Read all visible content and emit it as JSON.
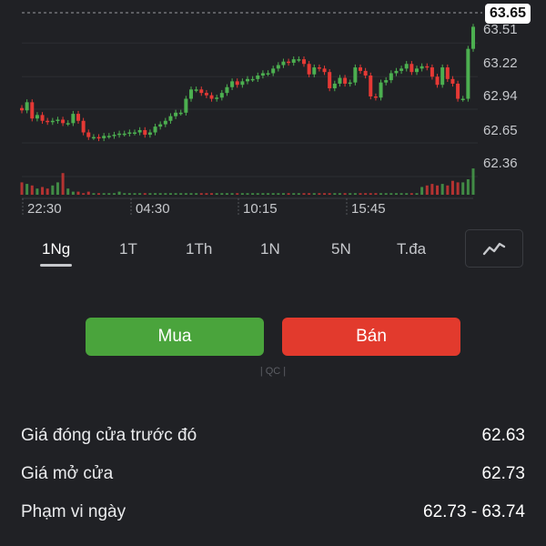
{
  "chart": {
    "last_price": "63.65",
    "y_axis_labels": [
      "63.51",
      "63.22",
      "62.94",
      "62.65",
      "62.36"
    ],
    "time_labels": [
      "22:30",
      "04:30",
      "10:15",
      "15:45"
    ],
    "colors": {
      "up": "#4caf50",
      "down": "#e53935",
      "background": "#202125"
    }
  },
  "chart_data": {
    "type": "candlestick",
    "y_ticks": [
      63.51,
      63.22,
      62.94,
      62.65,
      62.36
    ],
    "last_price": 63.65,
    "x_tick_labels": [
      "22:30",
      "04:30",
      "10:15",
      "15:45"
    ],
    "series": [
      {
        "name": "",
        "close": [
          62.93,
          63.0,
          62.86,
          62.89,
          62.84,
          62.83,
          62.84,
          62.85,
          62.82,
          62.82,
          62.9,
          62.84,
          62.74,
          62.7,
          62.7,
          62.69,
          62.71,
          62.71,
          62.72,
          62.73,
          62.73,
          62.74,
          62.74,
          62.76,
          62.72,
          62.74,
          62.79,
          62.81,
          62.84,
          62.88,
          62.91,
          62.91,
          63.03,
          63.11,
          63.11,
          63.08,
          63.06,
          63.03,
          63.04,
          63.08,
          63.13,
          63.18,
          63.15,
          63.18,
          63.2,
          63.2,
          63.23,
          63.25,
          63.25,
          63.29,
          63.32,
          63.35,
          63.34,
          63.37,
          63.37,
          63.33,
          63.24,
          63.3,
          63.29,
          63.26,
          63.12,
          63.16,
          63.21,
          63.16,
          63.17,
          63.3,
          63.27,
          63.23,
          63.05,
          63.04,
          63.17,
          63.19,
          63.25,
          63.27,
          63.29,
          63.33,
          63.26,
          63.29,
          63.31,
          63.3,
          63.22,
          63.15,
          63.3,
          63.2,
          63.16,
          63.03,
          63.03,
          63.46,
          63.65
        ]
      }
    ],
    "volume": [
      0.4,
      0.35,
      0.3,
      0.2,
      0.25,
      0.2,
      0.3,
      0.4,
      0.7,
      0.2,
      0.1,
      0.1,
      0.05,
      0.1,
      0.05,
      0.05,
      0.05,
      0.05,
      0.05,
      0.1,
      0.05,
      0.05,
      0.05,
      0.05,
      0.05,
      0.05,
      0.05,
      0.05,
      0.05,
      0.05,
      0.05,
      0.05,
      0.05,
      0.05,
      0.05,
      0.05,
      0.05,
      0.05,
      0.05,
      0.05,
      0.05,
      0.05,
      0.05,
      0.05,
      0.05,
      0.05,
      0.05,
      0.05,
      0.05,
      0.05,
      0.05,
      0.05,
      0.05,
      0.05,
      0.05,
      0.05,
      0.05,
      0.05,
      0.05,
      0.05,
      0.05,
      0.05,
      0.05,
      0.05,
      0.05,
      0.05,
      0.05,
      0.05,
      0.05,
      0.05,
      0.05,
      0.05,
      0.05,
      0.05,
      0.05,
      0.05,
      0.05,
      0.05,
      0.25,
      0.3,
      0.35,
      0.3,
      0.35,
      0.3,
      0.45,
      0.4,
      0.4,
      0.5,
      0.85
    ]
  },
  "tabs": [
    {
      "label": "1Ng",
      "active": true
    },
    {
      "label": "1T",
      "active": false
    },
    {
      "label": "1Th",
      "active": false
    },
    {
      "label": "1N",
      "active": false
    },
    {
      "label": "5N",
      "active": false
    },
    {
      "label": "T.đa",
      "active": false
    }
  ],
  "actions": {
    "buy_label": "Mua",
    "sell_label": "Bán"
  },
  "ad_label": "| QC |",
  "stats": [
    {
      "label": "Giá đóng cửa trước đó",
      "value": "62.63"
    },
    {
      "label": "Giá mở cửa",
      "value": "62.73"
    },
    {
      "label": "Phạm vi ngày",
      "value": "62.73 - 63.74"
    }
  ]
}
